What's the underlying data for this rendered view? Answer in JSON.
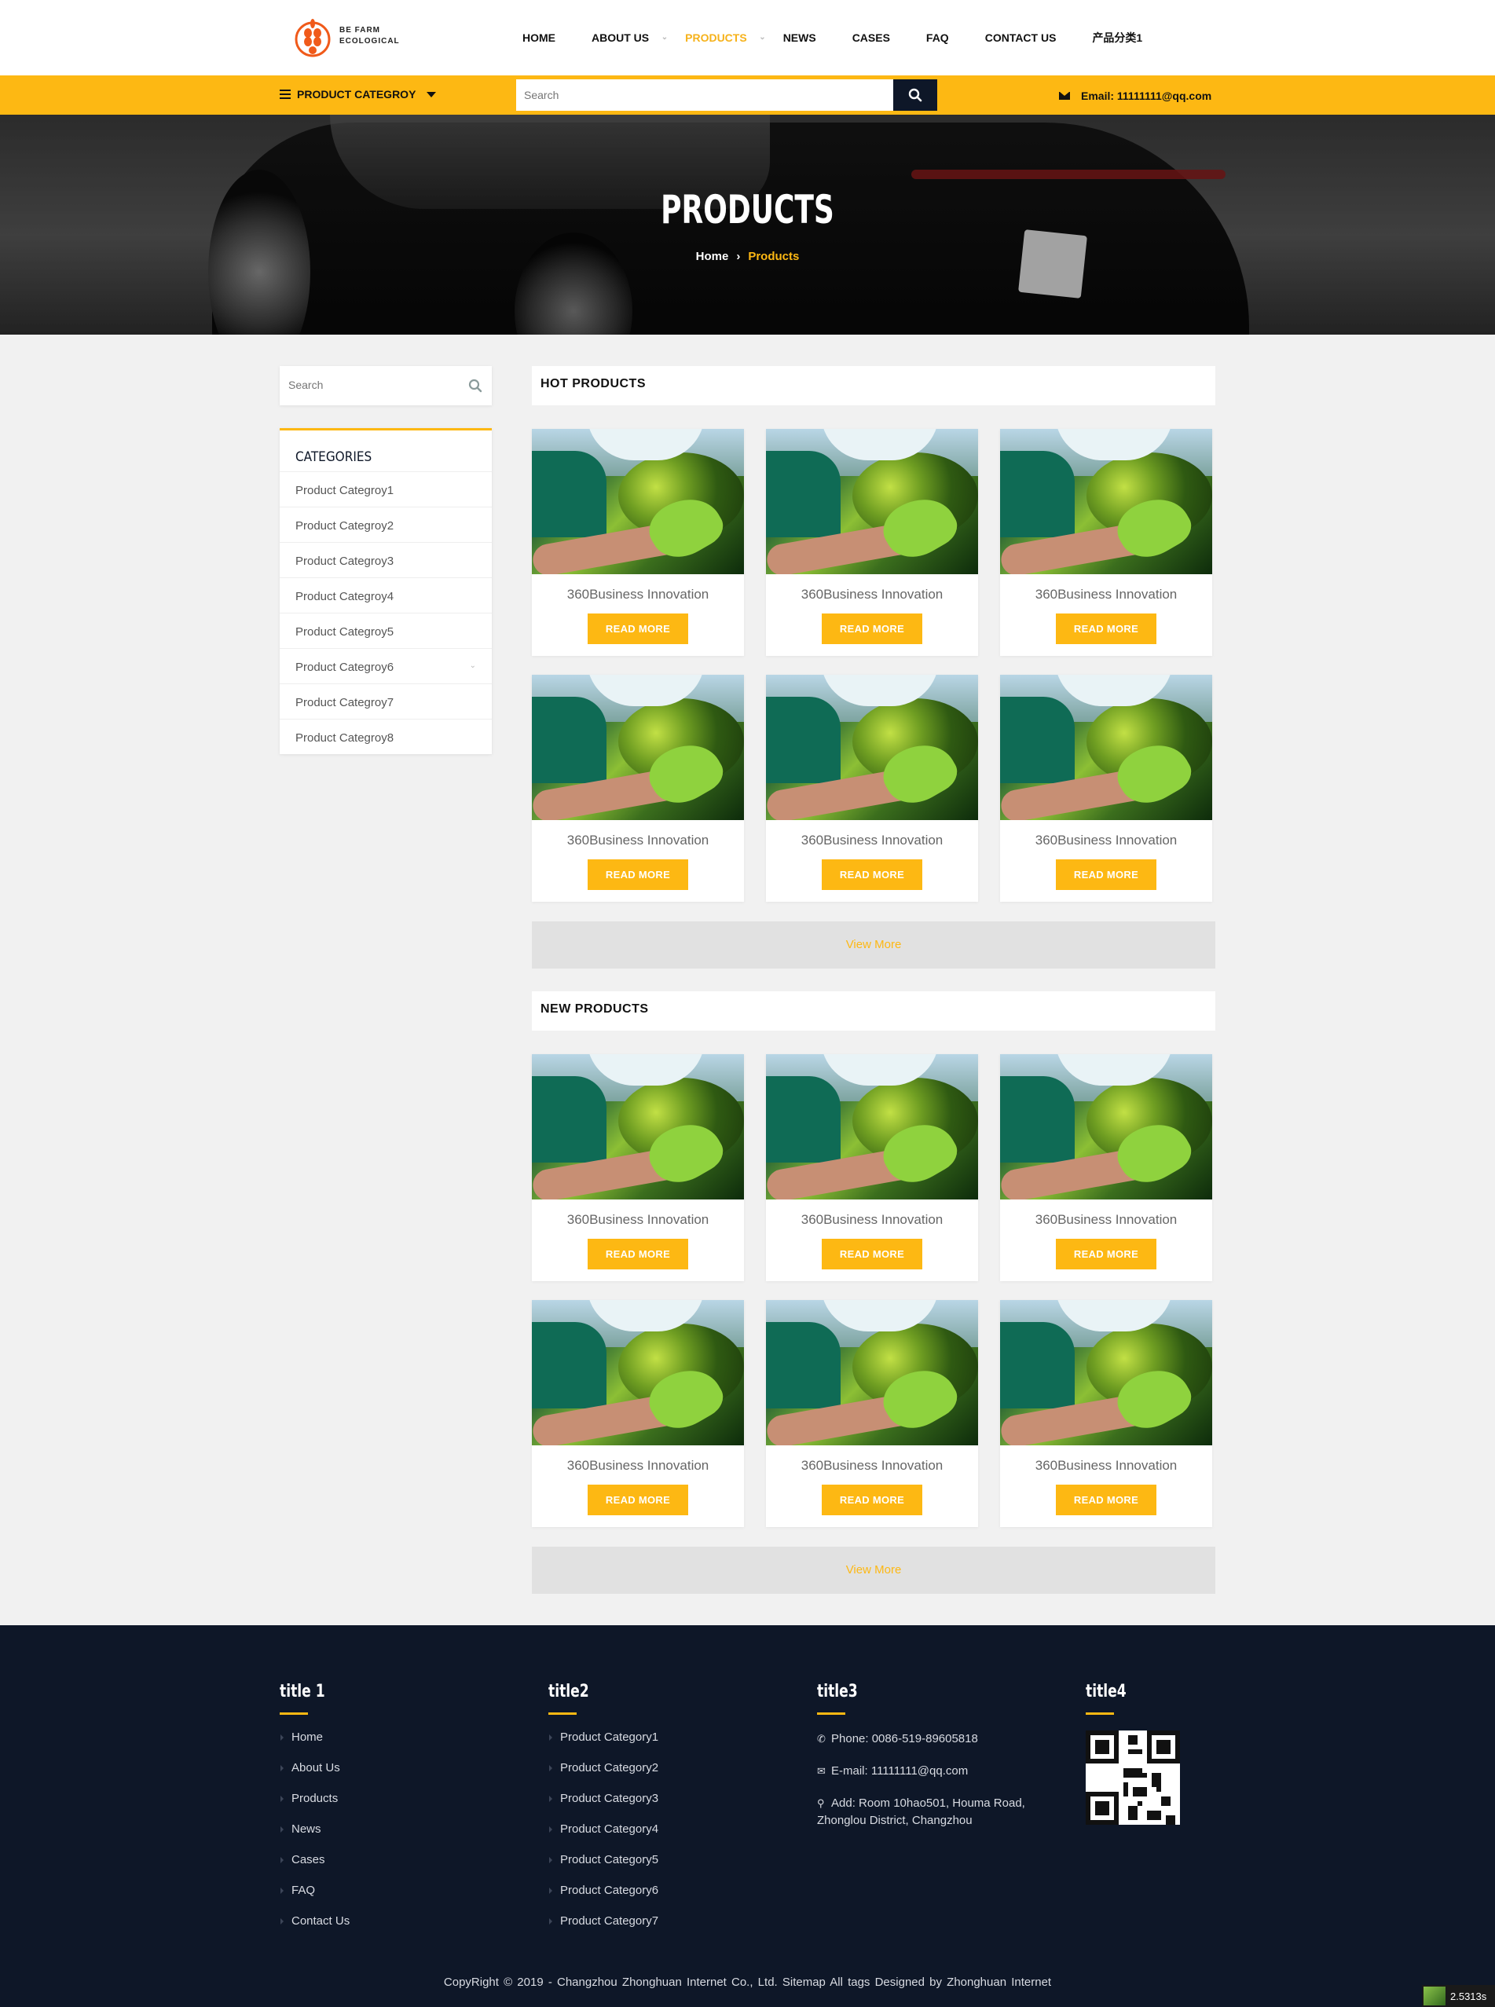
{
  "header": {
    "logo": {
      "line1": "BE FARM",
      "line2": "ECOLOGICAL"
    },
    "nav": [
      {
        "label": "HOME",
        "active": false,
        "has_dropdown": false
      },
      {
        "label": "ABOUT US",
        "active": false,
        "has_dropdown": true
      },
      {
        "label": "PRODUCTS",
        "active": true,
        "has_dropdown": true
      },
      {
        "label": "NEWS",
        "active": false,
        "has_dropdown": false
      },
      {
        "label": "CASES",
        "active": false,
        "has_dropdown": false
      },
      {
        "label": "FAQ",
        "active": false,
        "has_dropdown": false
      },
      {
        "label": "CONTACT US",
        "active": false,
        "has_dropdown": false
      },
      {
        "label": "产品分类1",
        "active": false,
        "has_dropdown": false
      }
    ],
    "category_button": "PRODUCT CATEGROY",
    "search_placeholder": "Search",
    "email": "Email: 11111111@qq.com"
  },
  "banner": {
    "title": "PRODUCTS",
    "breadcrumb": {
      "home": "Home",
      "current": "Products"
    }
  },
  "sidebar": {
    "search_placeholder": "Search",
    "categories_title": "CATEGORIES",
    "categories": [
      "Product Categroy1",
      "Product Categroy2",
      "Product Categroy3",
      "Product Categroy4",
      "Product Categroy5",
      "Product Categroy6",
      "Product Categroy7",
      "Product Categroy8"
    ]
  },
  "hot_products": {
    "title": "HOT PRODUCTS",
    "items": [
      {
        "title": "360Business Innovation",
        "button": "READ MORE"
      },
      {
        "title": "360Business Innovation",
        "button": "READ MORE"
      },
      {
        "title": "360Business Innovation",
        "button": "READ MORE"
      },
      {
        "title": "360Business Innovation",
        "button": "READ MORE"
      },
      {
        "title": "360Business Innovation",
        "button": "READ MORE"
      },
      {
        "title": "360Business Innovation",
        "button": "READ MORE"
      }
    ],
    "view_more": "View More"
  },
  "new_products": {
    "title": "NEW PRODUCTS",
    "items": [
      {
        "title": "360Business Innovation",
        "button": "READ MORE"
      },
      {
        "title": "360Business Innovation",
        "button": "READ MORE"
      },
      {
        "title": "360Business Innovation",
        "button": "READ MORE"
      },
      {
        "title": "360Business Innovation",
        "button": "READ MORE"
      },
      {
        "title": "360Business Innovation",
        "button": "READ MORE"
      },
      {
        "title": "360Business Innovation",
        "button": "READ MORE"
      }
    ],
    "view_more": "View More"
  },
  "footer": {
    "col1": {
      "title": "title 1",
      "links": [
        "Home",
        "About Us",
        "Products",
        "News",
        "Cases",
        "FAQ",
        "Contact Us"
      ]
    },
    "col2": {
      "title": "title2",
      "links": [
        "Product Category1",
        "Product Category2",
        "Product Category3",
        "Product Category4",
        "Product Category5",
        "Product Category6",
        "Product Category7"
      ]
    },
    "col3": {
      "title": "title3",
      "phone": "Phone: 0086-519-89605818",
      "email": "E-mail: 11111111@qq.com",
      "address_line1": "Add: Room 10hao501, Houma Road,",
      "address_line2": "Zhonglou District, Changzhou"
    },
    "col4": {
      "title": "title4"
    },
    "copyright": "CopyRight © 2019 -  Changzhou Zhonghuan Internet Co., Ltd.  Sitemap  All tags  Designed by Zhonghuan Internet"
  },
  "timer": "2.5313s",
  "colors": {
    "accent": "#fdb813",
    "navy": "#0e1728",
    "page_bg": "#f1f1f1"
  }
}
